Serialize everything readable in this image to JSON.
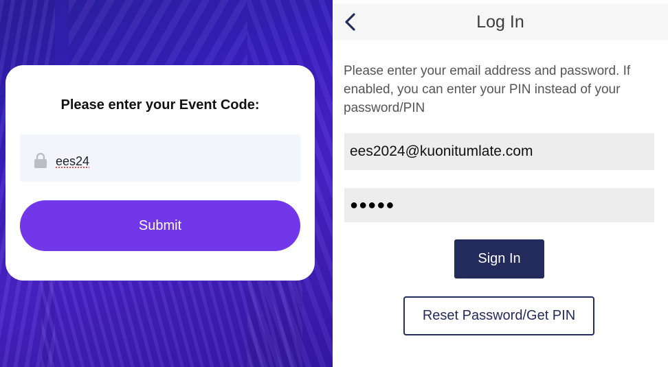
{
  "event_code_screen": {
    "prompt": "Please enter your Event Code:",
    "code_value": "ees24",
    "submit_label": "Submit",
    "colors": {
      "accent": "#7337ea",
      "background": "#3a1ec4"
    }
  },
  "login_screen": {
    "title": "Log In",
    "instructions": "Please enter your email address and password. If enabled, you can enter your PIN instead of your password/PIN",
    "email_value": "ees2024@kuonitumlate.com",
    "password_value": "●●●●●",
    "sign_in_label": "Sign In",
    "reset_label": "Reset Password/Get PIN",
    "colors": {
      "primary": "#232a5c",
      "field_bg": "#ededed"
    }
  }
}
